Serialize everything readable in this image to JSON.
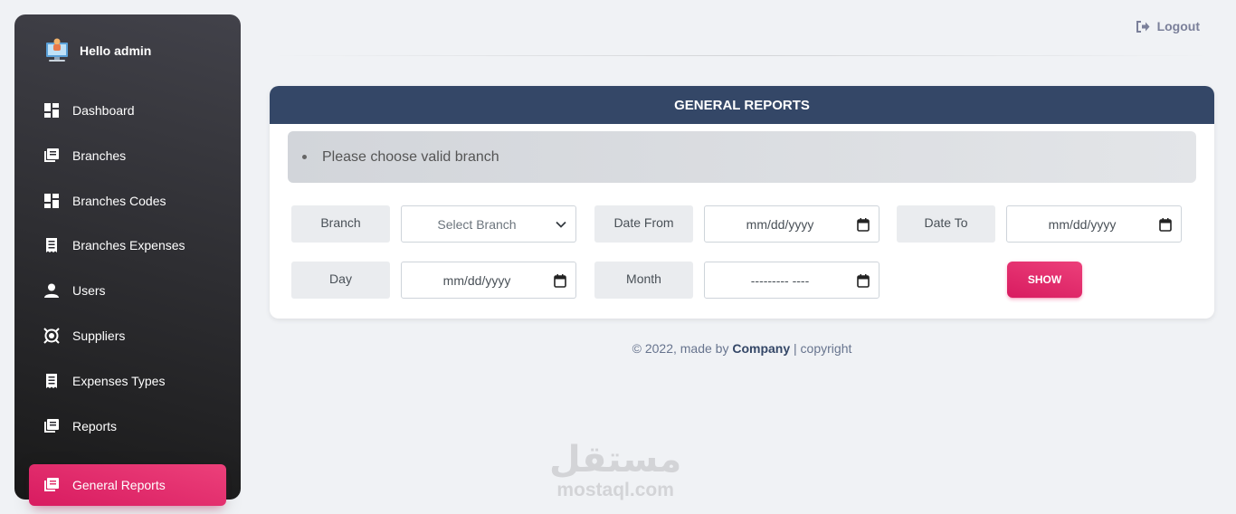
{
  "sidebar": {
    "greeting": "Hello admin",
    "items": [
      {
        "label": "Dashboard",
        "icon": "dashboard-icon"
      },
      {
        "label": "Branches",
        "icon": "library-icon"
      },
      {
        "label": "Branches Codes",
        "icon": "dashboard-icon"
      },
      {
        "label": "Branches Expenses",
        "icon": "receipt-icon"
      },
      {
        "label": "Users",
        "icon": "person-icon"
      },
      {
        "label": "Suppliers",
        "icon": "support-icon"
      },
      {
        "label": "Expenses Types",
        "icon": "receipt-icon"
      },
      {
        "label": "Reports",
        "icon": "library-icon"
      },
      {
        "label": "General Reports",
        "icon": "library-icon",
        "active": true
      }
    ],
    "active_color": "#e91e63"
  },
  "topbar": {
    "logout_label": "Logout"
  },
  "card": {
    "title": "GENERAL REPORTS",
    "alert_message": "Please choose valid branch",
    "header_color": "#344767",
    "form": {
      "branch_label": "Branch",
      "branch_select": "Select Branch",
      "date_from_label": "Date From",
      "date_from_value": "mm/dd/yyyy",
      "date_to_label": "Date To",
      "date_to_value": "mm/dd/yyyy",
      "day_label": "Day",
      "day_value": "mm/dd/yyyy",
      "month_label": "Month",
      "month_value": "--------- ----",
      "show_label": "SHOW"
    }
  },
  "footer": {
    "prefix": "© 2022, made by",
    "company": "Company",
    "suffix": "| copyright"
  },
  "watermark": {
    "arabic": "مستقل",
    "latin": "mostaql.com"
  }
}
